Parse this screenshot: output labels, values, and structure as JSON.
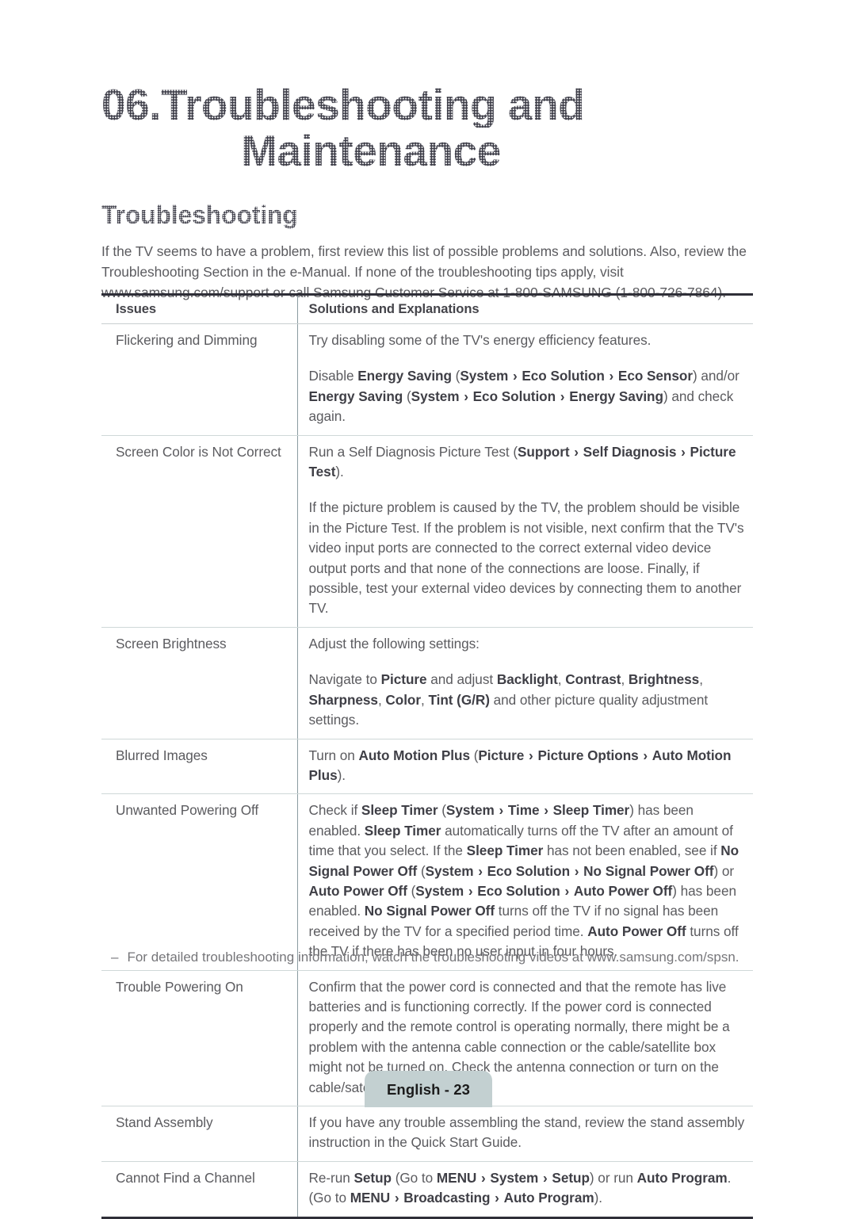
{
  "document": {
    "chapter_title_line1": "06.Troubleshooting and",
    "chapter_title_line2": "Maintenance",
    "section_heading": "Troubleshooting",
    "intro_paragraph": "If the TV seems to have a problem, first review this list of possible problems and solutions. Also, review the Troubleshooting Section in the e-Manual. If none of the troubleshooting tips apply, visit www.samsung.com/support or call Samsung Customer Service at 1-800-SAMSUNG (1-800-726-7864)."
  },
  "table": {
    "headers": {
      "issues": "Issues",
      "solutions": "Solutions and Explanations"
    },
    "rows": [
      {
        "issue": "Flickering and Dimming",
        "paragraphs": [
          [
            {
              "t": "Try disabling some of the TV's energy efficiency features.",
              "b": false
            }
          ],
          [
            {
              "t": "Disable ",
              "b": false
            },
            {
              "t": "Energy Saving",
              "b": true
            },
            {
              "t": " (",
              "b": false
            },
            {
              "t": "System",
              "b": true
            },
            {
              "t": " › ",
              "b": true
            },
            {
              "t": "Eco Solution",
              "b": true
            },
            {
              "t": " › ",
              "b": true
            },
            {
              "t": "Eco Sensor",
              "b": true
            },
            {
              "t": ") and/or ",
              "b": false
            },
            {
              "t": "Energy Saving",
              "b": true
            },
            {
              "t": " (",
              "b": false
            },
            {
              "t": "System",
              "b": true
            },
            {
              "t": " › ",
              "b": true
            },
            {
              "t": "Eco Solution",
              "b": true
            },
            {
              "t": " › ",
              "b": true
            },
            {
              "t": "Energy Saving",
              "b": true
            },
            {
              "t": ") and check again.",
              "b": false
            }
          ]
        ]
      },
      {
        "issue": "Screen Color is Not Correct",
        "paragraphs": [
          [
            {
              "t": "Run a Self Diagnosis Picture Test (",
              "b": false
            },
            {
              "t": "Support",
              "b": true
            },
            {
              "t": " › ",
              "b": true
            },
            {
              "t": "Self Diagnosis",
              "b": true
            },
            {
              "t": " › ",
              "b": true
            },
            {
              "t": "Picture Test",
              "b": true
            },
            {
              "t": ").",
              "b": false
            }
          ],
          [
            {
              "t": "If the picture problem is caused by the TV, the problem should be visible in the Picture Test. If the problem is not visible, next confirm that the TV's video input ports are connected to the correct external video device output ports and that none of the connections are loose. Finally, if possible, test your external video devices by connecting them to another TV.",
              "b": false
            }
          ]
        ]
      },
      {
        "issue": "Screen Brightness",
        "paragraphs": [
          [
            {
              "t": "Adjust the following settings:",
              "b": false
            }
          ],
          [
            {
              "t": "Navigate to ",
              "b": false
            },
            {
              "t": "Picture",
              "b": true
            },
            {
              "t": " and adjust ",
              "b": false
            },
            {
              "t": "Backlight",
              "b": true
            },
            {
              "t": ", ",
              "b": false
            },
            {
              "t": "Contrast",
              "b": true
            },
            {
              "t": ", ",
              "b": false
            },
            {
              "t": "Brightness",
              "b": true
            },
            {
              "t": ", ",
              "b": false
            },
            {
              "t": "Sharpness",
              "b": true
            },
            {
              "t": ", ",
              "b": false
            },
            {
              "t": "Color",
              "b": true
            },
            {
              "t": ", ",
              "b": false
            },
            {
              "t": "Tint (G/R)",
              "b": true
            },
            {
              "t": " and other picture quality adjustment settings.",
              "b": false
            }
          ]
        ]
      },
      {
        "issue": "Blurred Images",
        "paragraphs": [
          [
            {
              "t": "Turn on ",
              "b": false
            },
            {
              "t": "Auto Motion Plus",
              "b": true
            },
            {
              "t": " (",
              "b": false
            },
            {
              "t": "Picture",
              "b": true
            },
            {
              "t": " › ",
              "b": true
            },
            {
              "t": "Picture Options",
              "b": true
            },
            {
              "t": " › ",
              "b": true
            },
            {
              "t": "Auto Motion Plus",
              "b": true
            },
            {
              "t": ").",
              "b": false
            }
          ]
        ]
      },
      {
        "issue": "Unwanted Powering Off",
        "paragraphs": [
          [
            {
              "t": "Check if ",
              "b": false
            },
            {
              "t": "Sleep Timer",
              "b": true
            },
            {
              "t": " (",
              "b": false
            },
            {
              "t": "System",
              "b": true
            },
            {
              "t": " › ",
              "b": true
            },
            {
              "t": "Time",
              "b": true
            },
            {
              "t": " › ",
              "b": true
            },
            {
              "t": "Sleep Timer",
              "b": true
            },
            {
              "t": ") has been enabled. ",
              "b": false
            },
            {
              "t": "Sleep Timer",
              "b": true
            },
            {
              "t": " automatically turns off the TV after an amount of time that you select. If the ",
              "b": false
            },
            {
              "t": "Sleep Timer",
              "b": true
            },
            {
              "t": " has not been enabled, see if ",
              "b": false
            },
            {
              "t": "No Signal Power Off",
              "b": true
            },
            {
              "t": " (",
              "b": false
            },
            {
              "t": "System",
              "b": true
            },
            {
              "t": " › ",
              "b": true
            },
            {
              "t": "Eco Solution",
              "b": true
            },
            {
              "t": " › ",
              "b": true
            },
            {
              "t": "No Signal Power Off",
              "b": true
            },
            {
              "t": ") or ",
              "b": false
            },
            {
              "t": "Auto Power Off",
              "b": true
            },
            {
              "t": " (",
              "b": false
            },
            {
              "t": "System",
              "b": true
            },
            {
              "t": " › ",
              "b": true
            },
            {
              "t": "Eco Solution",
              "b": true
            },
            {
              "t": " › ",
              "b": true
            },
            {
              "t": "Auto Power Off",
              "b": true
            },
            {
              "t": ") has been enabled. ",
              "b": false
            },
            {
              "t": "No Signal Power Off",
              "b": true
            },
            {
              "t": " turns off the TV if no signal has been received by the TV for a specified period time. ",
              "b": false
            },
            {
              "t": "Auto Power Off",
              "b": true
            },
            {
              "t": " turns off the TV if there has been no user input in four hours.",
              "b": false
            }
          ]
        ]
      },
      {
        "issue": "Trouble Powering On",
        "paragraphs": [
          [
            {
              "t": "Confirm that the power cord is connected and that the remote has live batteries and is functioning correctly. If the power cord is connected properly and the remote control is operating normally, there might be a problem with the antenna cable connection or the cable/satellite box might not be turned on. Check the antenna connection or turn on the cable/satellite box.",
              "b": false
            }
          ]
        ]
      },
      {
        "issue": "Stand Assembly",
        "paragraphs": [
          [
            {
              "t": "If you have any trouble assembling the stand, review the stand assembly instruction in the Quick Start Guide.",
              "b": false
            }
          ]
        ]
      },
      {
        "issue": "Cannot Find a Channel",
        "paragraphs": [
          [
            {
              "t": "Re-run ",
              "b": false
            },
            {
              "t": "Setup",
              "b": true
            },
            {
              "t": " (Go to ",
              "b": false
            },
            {
              "t": "MENU",
              "b": true
            },
            {
              "t": " › ",
              "b": true
            },
            {
              "t": "System",
              "b": true
            },
            {
              "t": " › ",
              "b": true
            },
            {
              "t": "Setup",
              "b": true
            },
            {
              "t": ") or run ",
              "b": false
            },
            {
              "t": "Auto Program",
              "b": true
            },
            {
              "t": ". (Go to ",
              "b": false
            },
            {
              "t": "MENU",
              "b": true
            },
            {
              "t": " › ",
              "b": true
            },
            {
              "t": "Broadcasting",
              "b": true
            },
            {
              "t": " › ",
              "b": true
            },
            {
              "t": "Auto Program",
              "b": true
            },
            {
              "t": ").",
              "b": false
            }
          ]
        ]
      }
    ]
  },
  "footnote": {
    "marker": "–",
    "text": "For detailed troubleshooting information, watch the troubleshooting videos at www.samsung.com/spsn."
  },
  "footer": {
    "page_label": "English - 23"
  },
  "colors": {
    "body_text": "#5b5b5f",
    "bold_text": "#3f3f46",
    "heading": "#3d3d48",
    "table_outer_border": "#2f2f38",
    "table_row_border": "#cfd8d8",
    "table_column_divider": "#8b9ba1",
    "footer_tab_bg": "#c3d0d1"
  }
}
